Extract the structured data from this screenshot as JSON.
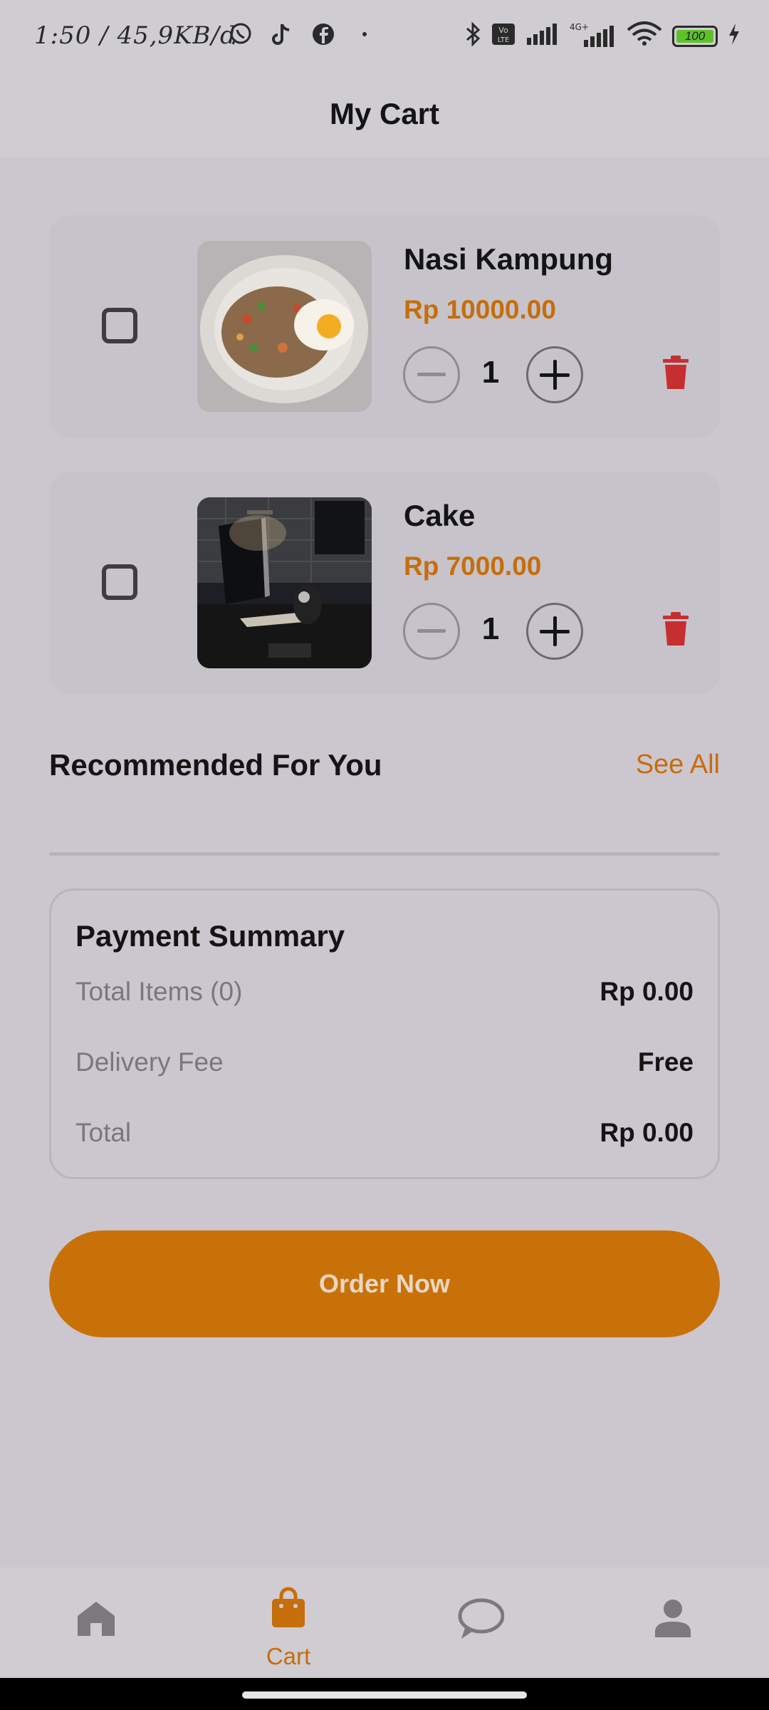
{
  "status_bar": {
    "time": "1:50",
    "speed": "45,9KB/d",
    "battery": "100",
    "network_4g": "4G+",
    "volte": "Vo LTE",
    "app_icons": [
      "whatsapp-icon",
      "tiktok-icon",
      "facebook-icon",
      "dot-icon"
    ],
    "system_icons": [
      "bluetooth-icon",
      "volte-icon",
      "signal-icon",
      "signal-4g-icon",
      "wifi-icon",
      "battery-icon",
      "charging-icon"
    ]
  },
  "header": {
    "title": "My Cart"
  },
  "cart": {
    "items": [
      {
        "name": "Nasi Kampung",
        "price": "Rp 10000.00",
        "qty": "1",
        "checked": false,
        "image": "fried-rice-with-egg"
      },
      {
        "name": "Cake",
        "price": "Rp 7000.00",
        "qty": "1",
        "checked": false,
        "image": "laptop-desk-photo"
      }
    ]
  },
  "recommended": {
    "title": "Recommended For You",
    "see_all": "See All"
  },
  "summary": {
    "title": "Payment Summary",
    "rows": [
      {
        "label": "Total Items (0)",
        "value": "Rp 0.00"
      },
      {
        "label": "Delivery Fee",
        "value": "Free"
      },
      {
        "label": "Total",
        "value": "Rp 0.00"
      }
    ]
  },
  "order_button": {
    "label": "Order Now"
  },
  "bottom_nav": {
    "items": [
      {
        "icon": "home-icon",
        "label": ""
      },
      {
        "icon": "shopping-bag-icon",
        "label": "Cart",
        "active": true
      },
      {
        "icon": "chat-icon",
        "label": ""
      },
      {
        "icon": "profile-icon",
        "label": ""
      }
    ]
  },
  "colors": {
    "accent": "#c97109",
    "price": "#c66d0c",
    "delete": "#c62f2f",
    "background": "#ccc6cf",
    "card": "#c7c3ca",
    "battery": "#5ec12c"
  }
}
